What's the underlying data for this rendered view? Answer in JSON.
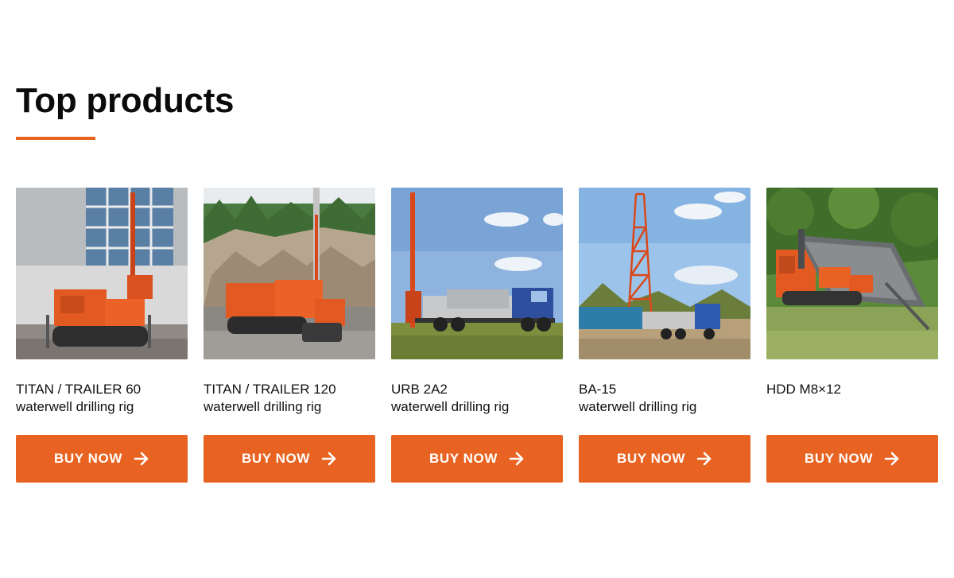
{
  "section": {
    "title": "Top products"
  },
  "accent_color": "#e86321",
  "products": [
    {
      "name": "TITAN / TRAILER 60",
      "subtitle": "waterwell drilling rig",
      "button_label": "BUY NOW",
      "button_icon": "arrow-right-icon"
    },
    {
      "name": "TITAN / TRAILER 120",
      "subtitle": "waterwell drilling rig",
      "button_label": "BUY NOW",
      "button_icon": "arrow-right-icon"
    },
    {
      "name": "URB 2A2",
      "subtitle": "waterwell drilling rig",
      "button_label": "BUY NOW",
      "button_icon": "arrow-right-icon"
    },
    {
      "name": "BA-15",
      "subtitle": "waterwell drilling rig",
      "button_label": "BUY NOW",
      "button_icon": "arrow-right-icon"
    },
    {
      "name": "HDD M8×12",
      "subtitle": "",
      "button_label": "BUY NOW",
      "button_icon": "arrow-right-icon"
    }
  ]
}
